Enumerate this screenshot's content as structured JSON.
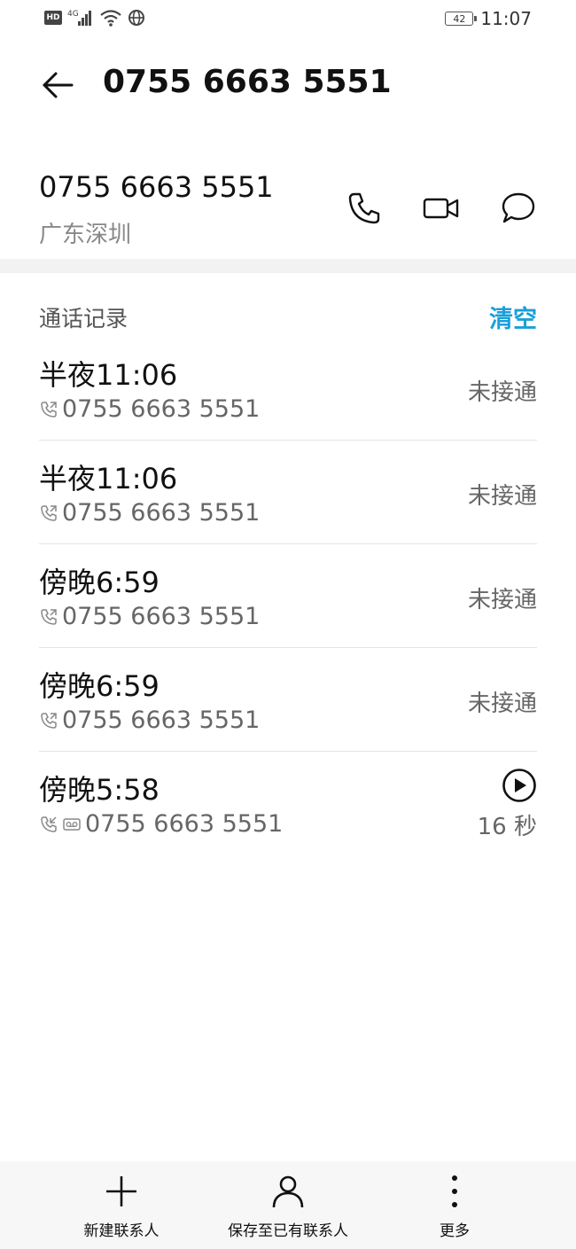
{
  "status_bar": {
    "network_badge": "HD",
    "signal_type": "4G",
    "battery_level": "42",
    "time": "11:07"
  },
  "header": {
    "title": "0755 6663 5551"
  },
  "contact": {
    "number": "0755 6663 5551",
    "location": "广东深圳"
  },
  "call_log": {
    "title": "通话记录",
    "clear_label": "清空",
    "items": [
      {
        "time": "半夜11:06",
        "number": "0755 6663 5551",
        "status": "未接通"
      },
      {
        "time": "半夜11:06",
        "number": "0755 6663 5551",
        "status": "未接通"
      },
      {
        "time": "傍晚6:59",
        "number": "0755 6663 5551",
        "status": "未接通"
      },
      {
        "time": "傍晚6:59",
        "number": "0755 6663 5551",
        "status": "未接通"
      },
      {
        "time": "傍晚5:58",
        "number": "0755 6663 5551",
        "duration": "16 秒"
      }
    ]
  },
  "bottom_bar": {
    "new_contact_label": "新建联系人",
    "save_existing_label": "保存至已有联系人",
    "more_label": "更多"
  },
  "colors": {
    "accent": "#1a9fd9",
    "secondary_text": "#666666",
    "divider_band": "#f2f2f2"
  }
}
